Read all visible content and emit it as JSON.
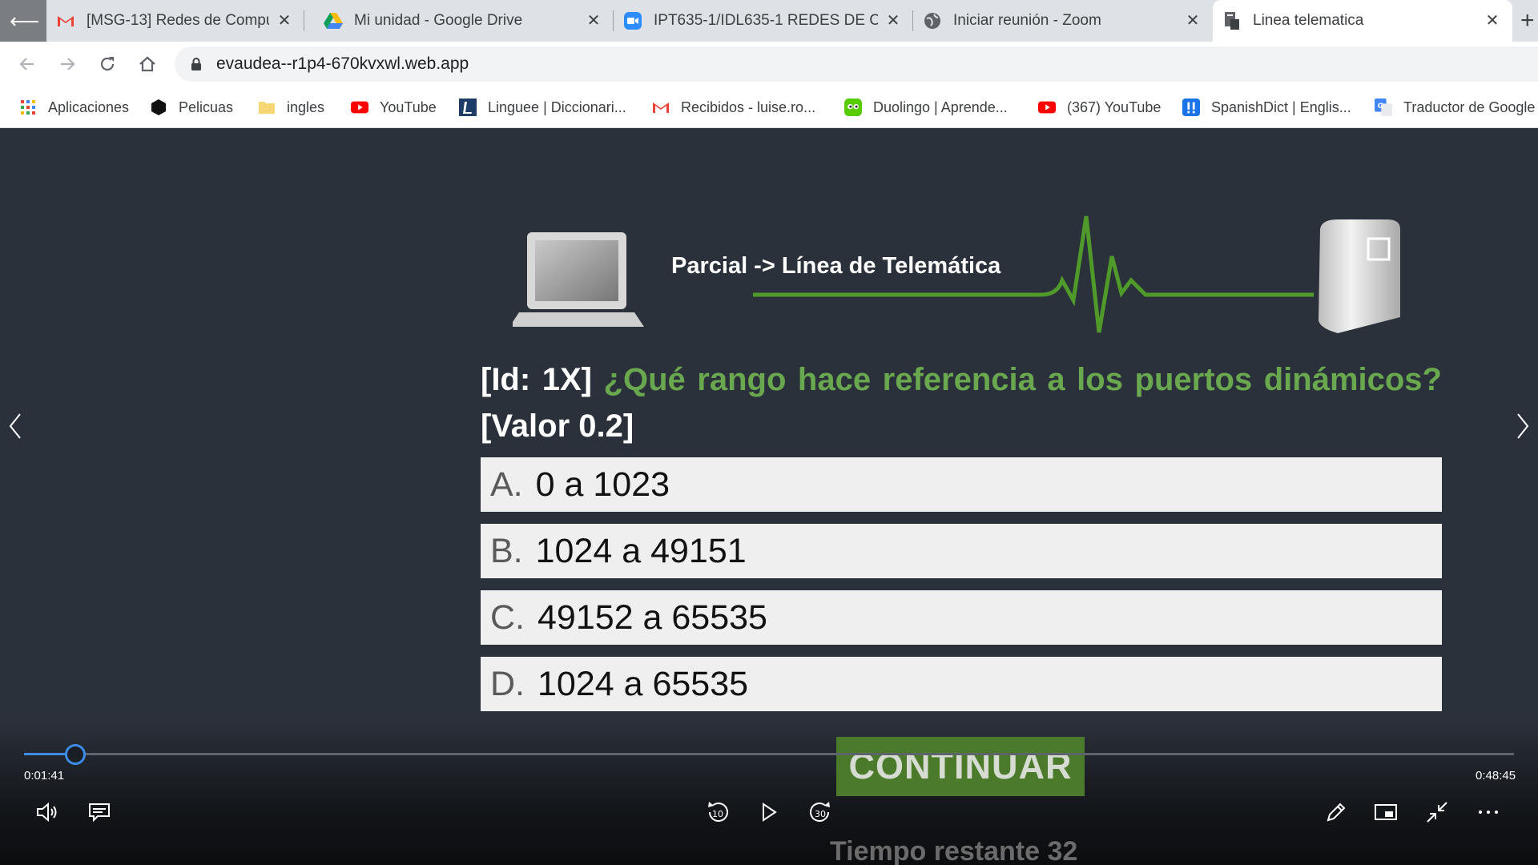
{
  "tabs": [
    {
      "label": "[MSG-13] Redes de Computadores",
      "icon": "gmail-icon"
    },
    {
      "label": "Mi unidad - Google Drive",
      "icon": "google-drive-icon"
    },
    {
      "label": "IPT635-1/IDL635-1 REDES DE COMPUTADORES",
      "icon": "zoom-icon"
    },
    {
      "label": "Iniciar reunión - Zoom",
      "icon": "globe-icon"
    },
    {
      "label": "Linea telematica",
      "icon": "page-icon",
      "active": true
    }
  ],
  "address_bar": {
    "url": "evaudea--r1p4-670kvxwl.web.app"
  },
  "bookmarks": [
    {
      "label": "Aplicaciones",
      "icon": "apps-grid-icon"
    },
    {
      "label": "Pelicuas",
      "icon": "hexagon-icon"
    },
    {
      "label": "ingles",
      "icon": "folder-icon"
    },
    {
      "label": "YouTube",
      "icon": "youtube-icon"
    },
    {
      "label": "Linguee | Diccionari...",
      "icon": "linguee-icon"
    },
    {
      "label": "Recibidos - luise.ro...",
      "icon": "gmail-icon"
    },
    {
      "label": "Duolingo | Aprende...",
      "icon": "duolingo-icon"
    },
    {
      "label": "(367) YouTube",
      "icon": "youtube-icon"
    },
    {
      "label": "SpanishDict | Englis...",
      "icon": "spanishdict-icon"
    },
    {
      "label": "Traductor de Google",
      "icon": "google-translate-icon"
    }
  ],
  "quiz": {
    "banner_title": "Parcial -> Línea de Telemática",
    "question_id": "[Id: 1X]",
    "question_text": "¿Qué rango hace referencia a los puertos dinámicos?",
    "question_value": "[Valor 0.2]",
    "options": [
      {
        "letter": "A.",
        "text": "0 a 1023"
      },
      {
        "letter": "B.",
        "text": "1024 a 49151"
      },
      {
        "letter": "C.",
        "text": "49152 a 65535"
      },
      {
        "letter": "D.",
        "text": "1024 a 65535"
      }
    ],
    "continue_label": "CONTINUAR",
    "remaining_label": "Tiempo restante 32"
  },
  "player": {
    "current_time": "0:01:41",
    "total_time": "0:48:45",
    "progress": 0.0345,
    "skip_back_seconds": "10",
    "skip_forward_seconds": "30"
  },
  "colors": {
    "question_green": "#6aa84f",
    "seek_blue": "#3c8ce7",
    "continue_bg": "#4a7a2a"
  }
}
